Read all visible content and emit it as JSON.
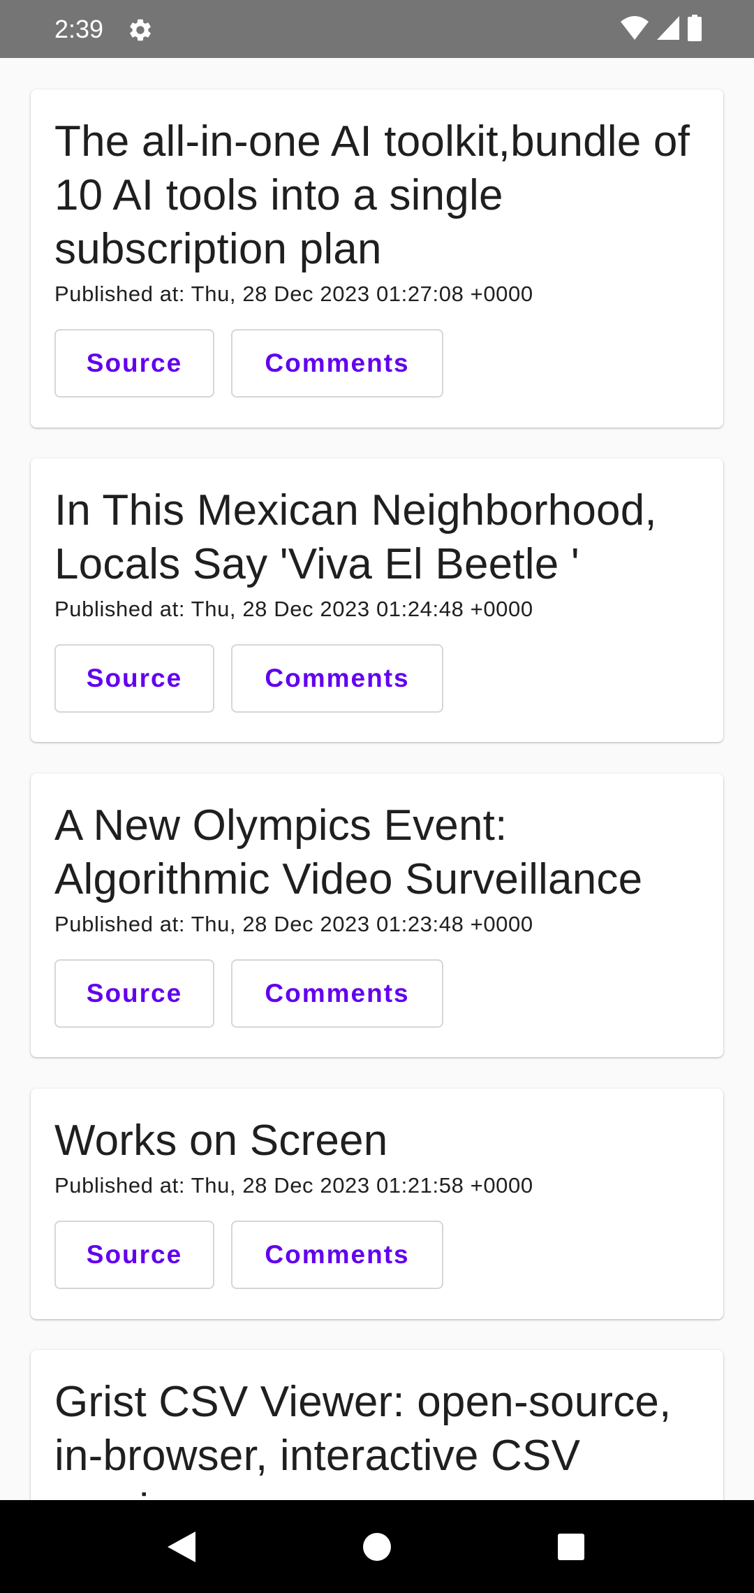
{
  "status_bar": {
    "time": "2:39",
    "left_icons": [
      "gear-icon"
    ],
    "right_icons": [
      "wifi-icon",
      "cell-signal-icon",
      "battery-icon"
    ]
  },
  "colors": {
    "accent": "#6200ee",
    "status_bar": "#757575",
    "background": "#fafafa",
    "card": "#ffffff",
    "nav_bar": "#000000"
  },
  "articles": [
    {
      "title": "The all-in-one AI toolkit,bundle of 10 AI tools into a single subscription plan",
      "published": "Published at: Thu, 28 Dec 2023 01:27:08 +0000",
      "source_label": "Source",
      "comments_label": "Comments"
    },
    {
      "title": "In This Mexican Neighborhood, Locals Say 'Viva El Beetle '",
      "published": "Published at: Thu, 28 Dec 2023 01:24:48 +0000",
      "source_label": "Source",
      "comments_label": "Comments"
    },
    {
      "title": "A New Olympics Event: Algorithmic Video Surveillance",
      "published": "Published at: Thu, 28 Dec 2023 01:23:48 +0000",
      "source_label": "Source",
      "comments_label": "Comments"
    },
    {
      "title": "Works on Screen",
      "published": "Published at: Thu, 28 Dec 2023 01:21:58 +0000",
      "source_label": "Source",
      "comments_label": "Comments"
    },
    {
      "title": "Grist CSV Viewer: open-source, in-browser, interactive CSV preview"
    }
  ],
  "nav_bar": {
    "buttons": [
      "back-icon",
      "home-icon",
      "recents-icon"
    ]
  }
}
